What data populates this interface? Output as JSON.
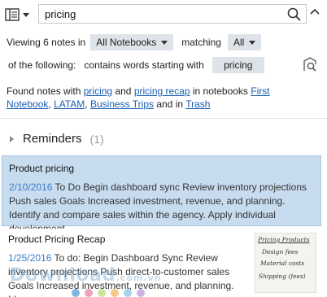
{
  "search": {
    "value": "pricing"
  },
  "filter": {
    "viewing_prefix": "Viewing 6 notes in",
    "notebook": "All Notebooks",
    "matching": "matching",
    "match_mode": "All",
    "of_following": "of the following:",
    "condition": "contains words starting with",
    "term": "pricing"
  },
  "found": {
    "prefix": "Found notes with",
    "link1": "pricing",
    "and1": "and",
    "link2": "pricing recap",
    "in_notebooks": "in notebooks",
    "nb1": "First Notebook",
    "sep1": ",",
    "nb2": "LATAM",
    "sep2": ",",
    "nb3": "Business Trips",
    "and_in": "and in",
    "nb4": "Trash"
  },
  "reminders": {
    "label": "Reminders",
    "count": "(1)"
  },
  "notes": [
    {
      "title": "Product pricing",
      "date": "2/10/2016",
      "snippet": "To Do Begin dashboard sync Review inventory projections Push sales Goals Increased investment, revenue, and planning. Identify and compare sales within the agency. Apply individual development ..."
    },
    {
      "title": "Product Pricing Recap",
      "date": "1/25/2016",
      "snippet": "To do: Begin Dashboard Sync Review inventory projections Push direct-to-customer sales Goals Increased investment, revenue, and planning. Id...",
      "thumbnail_lines": [
        "Pricing Products",
        "Design fees",
        "Material costs",
        "Shipping (fees)"
      ]
    }
  ],
  "watermark": {
    "text": "Download",
    "suffix": ".com.vn"
  },
  "colors": {
    "selected_bg": "#c7dcef",
    "link": "#1a5fb4",
    "chip_bg": "#dde3e8",
    "date": "#3a7dc6"
  }
}
